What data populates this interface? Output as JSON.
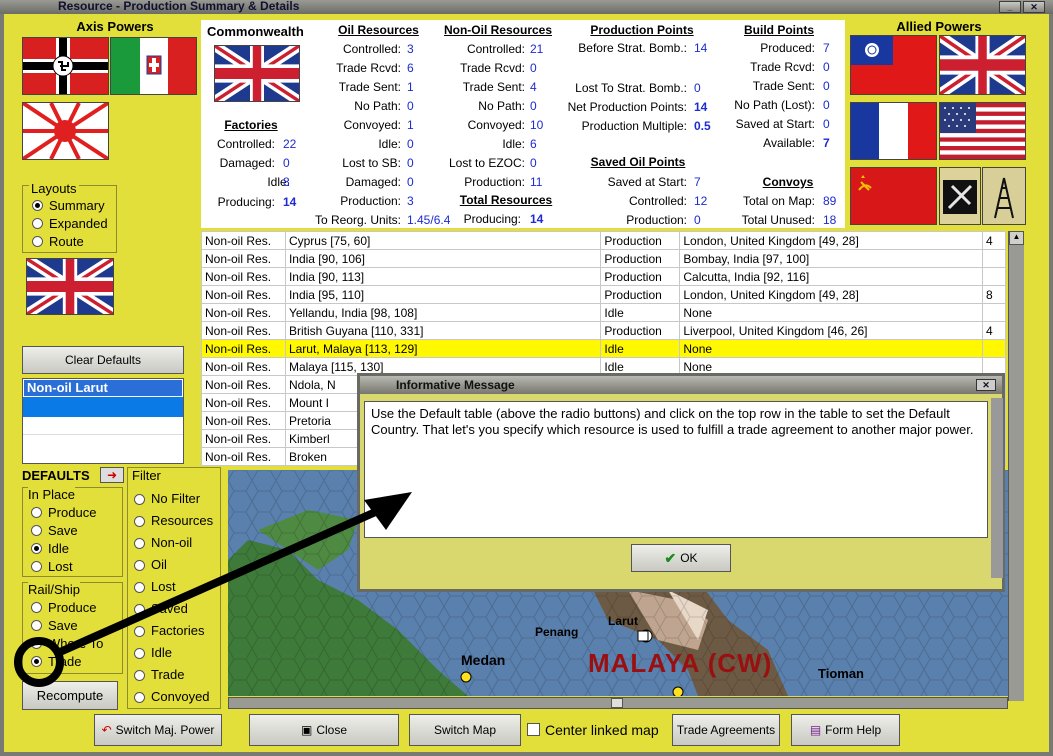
{
  "window": {
    "title": "Resource - Production Summary & Details"
  },
  "axis": {
    "title": "Axis Powers"
  },
  "allied": {
    "title": "Allied Powers"
  },
  "layouts": {
    "title": "Layouts",
    "options": [
      "Summary",
      "Expanded",
      "Route"
    ],
    "selected": 0
  },
  "clear_defaults": "Clear Defaults",
  "defaults_list": {
    "rows": [
      "Non-oil Larut",
      "",
      "",
      ""
    ]
  },
  "defaults": {
    "title": "DEFAULTS",
    "in_place": {
      "title": "In Place",
      "options": [
        "Produce",
        "Save",
        "Idle",
        "Lost"
      ],
      "selected": 2
    },
    "rail_ship": {
      "title": "Rail/Ship",
      "options": [
        "Produce",
        "Save",
        "Where To",
        "Trade"
      ],
      "selected": 3
    }
  },
  "filter": {
    "title": "Filter",
    "options": [
      "No Filter",
      "Resources",
      "Non-oil",
      "Oil",
      "Lost",
      "Saved",
      "Factories",
      "Idle",
      "Trade",
      "Convoyed"
    ]
  },
  "recompute": "Recompute",
  "summary": {
    "country": "Commonwealth",
    "factories": {
      "title": "Factories",
      "rows": [
        [
          "Controlled:",
          "22"
        ],
        [
          "Damaged:",
          "0"
        ],
        [
          "Idle:",
          "8"
        ],
        [
          "Producing:",
          "14"
        ]
      ]
    },
    "oil": {
      "title": "Oil Resources",
      "rows": [
        [
          "Controlled:",
          "3"
        ],
        [
          "Trade Rcvd:",
          "6"
        ],
        [
          "Trade Sent:",
          "1"
        ],
        [
          "No Path:",
          "0"
        ],
        [
          "Convoyed:",
          "1"
        ],
        [
          "Idle:",
          "0"
        ],
        [
          "Lost to SB:",
          "0"
        ],
        [
          "Damaged:",
          "0"
        ],
        [
          "Production:",
          "3"
        ],
        [
          "To Reorg. Units:",
          "1.45/6.4"
        ]
      ]
    },
    "nonoil": {
      "title": "Non-Oil Resources",
      "rows": [
        [
          "Controlled:",
          "21"
        ],
        [
          "Trade Rcvd:",
          "0"
        ],
        [
          "Trade Sent:",
          "4"
        ],
        [
          "No Path:",
          "0"
        ],
        [
          "Convoyed:",
          "10"
        ],
        [
          "Idle:",
          "6"
        ],
        [
          "Lost to EZOC:",
          "0"
        ],
        [
          "Production:",
          "11"
        ]
      ]
    },
    "total": {
      "title": "Total Resources",
      "rows": [
        [
          "Producing:",
          "14"
        ]
      ]
    },
    "pp": {
      "title": "Production Points",
      "rows": [
        [
          "Before Strat. Bomb.:",
          "14"
        ],
        [
          "Lost To Strat. Bomb.:",
          "0"
        ],
        [
          "Net Production Points:",
          "14"
        ],
        [
          "Production Multiple:",
          "0.5"
        ]
      ]
    },
    "saved_oil": {
      "title": "Saved Oil Points",
      "rows": [
        [
          "Saved at Start:",
          "7"
        ],
        [
          "Controlled:",
          "12"
        ],
        [
          "Production:",
          "0"
        ]
      ]
    },
    "bp": {
      "title": "Build Points",
      "rows": [
        [
          "Produced:",
          "7"
        ],
        [
          "Trade Rcvd:",
          "0"
        ],
        [
          "Trade Sent:",
          "0"
        ],
        [
          "No Path (Lost):",
          "0"
        ],
        [
          "Saved at Start:",
          "0"
        ],
        [
          "Available:",
          "7"
        ]
      ]
    },
    "convoys": {
      "title": "Convoys",
      "rows": [
        [
          "Total on Map:",
          "89"
        ],
        [
          "Total Unused:",
          "18"
        ]
      ]
    }
  },
  "table": {
    "rows": [
      [
        "Non-oil Res.",
        "Cyprus [75, 60]",
        "Production",
        "London, United Kingdom [49, 28]",
        "4"
      ],
      [
        "Non-oil Res.",
        "India [90, 106]",
        "Production",
        "Bombay, India [97, 100]",
        ""
      ],
      [
        "Non-oil Res.",
        "India [90, 113]",
        "Production",
        "Calcutta, India [92, 116]",
        ""
      ],
      [
        "Non-oil Res.",
        "India [95, 110]",
        "Production",
        "London, United Kingdom [49, 28]",
        "8"
      ],
      [
        "Non-oil Res.",
        "Yellandu, India [98, 108]",
        "Idle",
        "None",
        ""
      ],
      [
        "Non-oil Res.",
        "British Guyana [110, 331]",
        "Production",
        "Liverpool, United Kingdom [46, 26]",
        "4"
      ],
      [
        "Non-oil Res.",
        "Larut, Malaya [113, 129]",
        "Idle",
        "None",
        ""
      ],
      [
        "Non-oil Res.",
        "Malaya [115, 130]",
        "Idle",
        "None",
        ""
      ],
      [
        "Non-oil Res.",
        "Ndola, N",
        "",
        "",
        ""
      ],
      [
        "Non-oil Res.",
        "Mount I",
        "",
        "",
        ""
      ],
      [
        "Non-oil Res.",
        "Pretoria",
        "",
        "",
        ""
      ],
      [
        "Non-oil Res.",
        "Kimberl",
        "",
        "",
        ""
      ],
      [
        "Non-oil Res.",
        "Broken",
        "",
        "",
        ""
      ]
    ],
    "selected_row": 6
  },
  "map": {
    "labels": {
      "medan": "Medan",
      "penang": "Penang",
      "larut": "Larut",
      "malaya": "MALAYA (CW)",
      "tioman": "Tioman"
    }
  },
  "dialog": {
    "title": "Informative Message",
    "text": "Use the Default table (above the radio buttons) and click on the top row in the table to set the Default Country.  That let's you specify which resource is used to fulfill a trade agreement to another major power.",
    "ok": "OK"
  },
  "bottom": {
    "switch_power": "Switch Maj. Power",
    "close": "Close",
    "switch_map": "Switch Map",
    "center_map": "Center linked map",
    "trade": "Trade Agreements",
    "help": "Form Help"
  },
  "colors": {
    "panel": "#e3df3a",
    "selected": "#fff800",
    "link": "#1d2bd0",
    "sea": "#587ea8",
    "annotation": "#000000"
  }
}
